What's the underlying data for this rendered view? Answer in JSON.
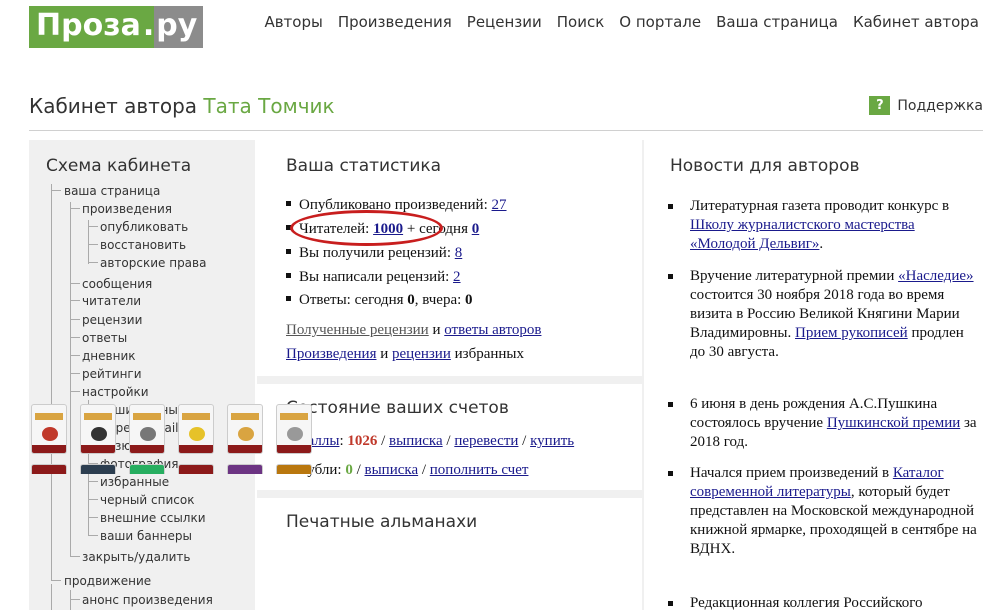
{
  "logo": {
    "main": "Проза",
    "dot": ".",
    "tld": "ру"
  },
  "topnav": [
    "Авторы",
    "Произведения",
    "Рецензии",
    "Поиск",
    "О портале",
    "Ваша страница",
    "Кабинет автора"
  ],
  "page_title": {
    "prefix": "Кабинет автора",
    "author": "Тата Томчик"
  },
  "support": {
    "icon": "?",
    "label": "Поддержка"
  },
  "sidebar": {
    "title": "Схема кабинета",
    "items": [
      "ваша страница",
      "произведения",
      "опубликовать",
      "восстановить",
      "авторские права",
      "сообщения",
      "читатели",
      "рецензии",
      "ответы",
      "дневник",
      "рейтинги",
      "настройки",
      "ваши данные",
      "адрес e-mail",
      "резюме",
      "фотография",
      "избранные",
      "черный список",
      "внешние ссылки",
      "ваши баннеры",
      "закрыть/удалить",
      "продвижение",
      "анонс произведения"
    ]
  },
  "stats": {
    "title": "Ваша статистика",
    "published_label": "Опубликовано произведений:",
    "published_value": "27",
    "readers_label": "Читателей:",
    "readers_value": "1000",
    "readers_plus": "+",
    "readers_today_label": "сегодня",
    "readers_today_value": "0",
    "reviews_got_label": "Вы получили рецензий:",
    "reviews_got_value": "8",
    "reviews_wrote_label": "Вы написали рецензий:",
    "reviews_wrote_value": "2",
    "answers_label": "Ответы: сегодня",
    "answers_today": "0",
    "answers_yesterday_label": ", вчера:",
    "answers_yesterday": "0",
    "link_received_reviews": "Полученные рецензии",
    "link_and": "и",
    "link_author_answers": "ответы авторов",
    "link_works": "Произведения",
    "link_and2": "и",
    "link_reviews": "рецензии",
    "link_favorites_suffix": "избранных"
  },
  "accounts": {
    "title": "Состояние ваших счетов",
    "points_label": "Баллы",
    "points_colon": ":",
    "points_value": "1026",
    "sep": "/",
    "statement": "выписка",
    "transfer": "перевести",
    "buy": "купить",
    "rubles_label": "Рубли:",
    "rubles_value": "0",
    "rubles_statement": "выписка",
    "topup": "пополнить счет"
  },
  "almanacs": {
    "title": "Печатные альманахи"
  },
  "news": {
    "title": "Новости для авторов",
    "items": [
      {
        "before": "Литературная газета проводит конкурс в ",
        "link": "Школу журналистского мастерства «Молодой Дельвиг»",
        "after": "."
      },
      {
        "before": "Вручение литературной премии ",
        "link": "«Наследие»",
        "after": " состоится 30 ноября 2018 года во время визита в Россию Великой Княгини Марии Владимировны. ",
        "link2": "Прием рукописей",
        "after2": " продлен до 30 августа."
      },
      {
        "before": "6 июня в день рождения А.С.Пушкина состоялось вручение ",
        "link": "Пушкинской премии",
        "after": " за 2018 год."
      },
      {
        "before": "Начался прием произведений в ",
        "link": "Каталог современной литературы",
        "after": ", который будет представлен на Московской международной книжной ярмарке, проходящей в сентябре на ВДНХ."
      },
      {
        "before": "Редакционная коллегия Российского",
        "link": "",
        "after": ""
      }
    ]
  },
  "colors": {
    "brand_green": "#6aa843",
    "logo_gray": "#8c8c8c",
    "highlight_red": "#c81e1e",
    "link_blue": "#1a1a8c"
  }
}
